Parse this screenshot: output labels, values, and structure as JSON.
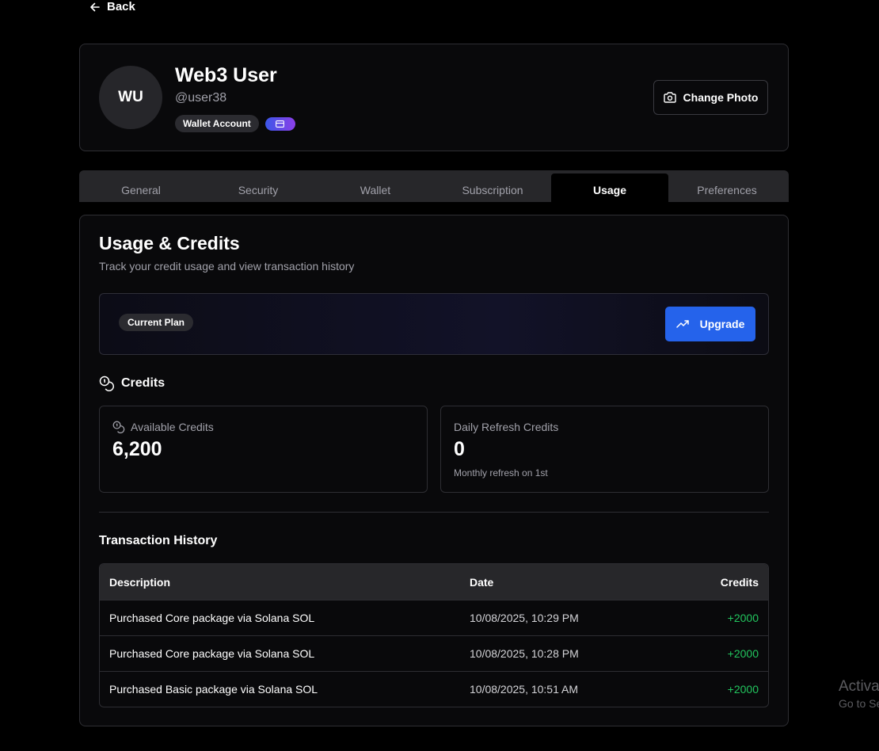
{
  "nav": {
    "back_label": "Back"
  },
  "profile": {
    "initials": "WU",
    "name": "Web3 User",
    "handle": "@user38",
    "account_badge": "Wallet Account",
    "change_photo_label": "Change Photo"
  },
  "tabs": [
    {
      "label": "General",
      "active": false
    },
    {
      "label": "Security",
      "active": false
    },
    {
      "label": "Wallet",
      "active": false
    },
    {
      "label": "Subscription",
      "active": false
    },
    {
      "label": "Usage",
      "active": true
    },
    {
      "label": "Preferences",
      "active": false
    }
  ],
  "usage": {
    "title": "Usage & Credits",
    "subtitle": "Track your credit usage and view transaction history",
    "plan_chip": "Current Plan",
    "upgrade_label": "Upgrade",
    "credits_heading": "Credits",
    "available": {
      "label": "Available Credits",
      "value": "6,200"
    },
    "daily": {
      "label": "Daily Refresh Credits",
      "value": "0",
      "note": "Monthly refresh on 1st"
    }
  },
  "transactions": {
    "heading": "Transaction History",
    "columns": {
      "description": "Description",
      "date": "Date",
      "credits": "Credits"
    },
    "rows": [
      {
        "description": "Purchased Core package via Solana SOL",
        "date": "10/08/2025, 10:29 PM",
        "credits": "+2000"
      },
      {
        "description": "Purchased Core package via Solana SOL",
        "date": "10/08/2025, 10:28 PM",
        "credits": "+2000"
      },
      {
        "description": "Purchased Basic package via Solana SOL",
        "date": "10/08/2025, 10:51 AM",
        "credits": "+2000"
      }
    ]
  },
  "watermark": {
    "line1": "Activa",
    "line2": "Go to Se"
  },
  "colors": {
    "accent": "#2563eb",
    "positive": "#22c55e",
    "background": "#000000",
    "panel": "#09090b"
  }
}
